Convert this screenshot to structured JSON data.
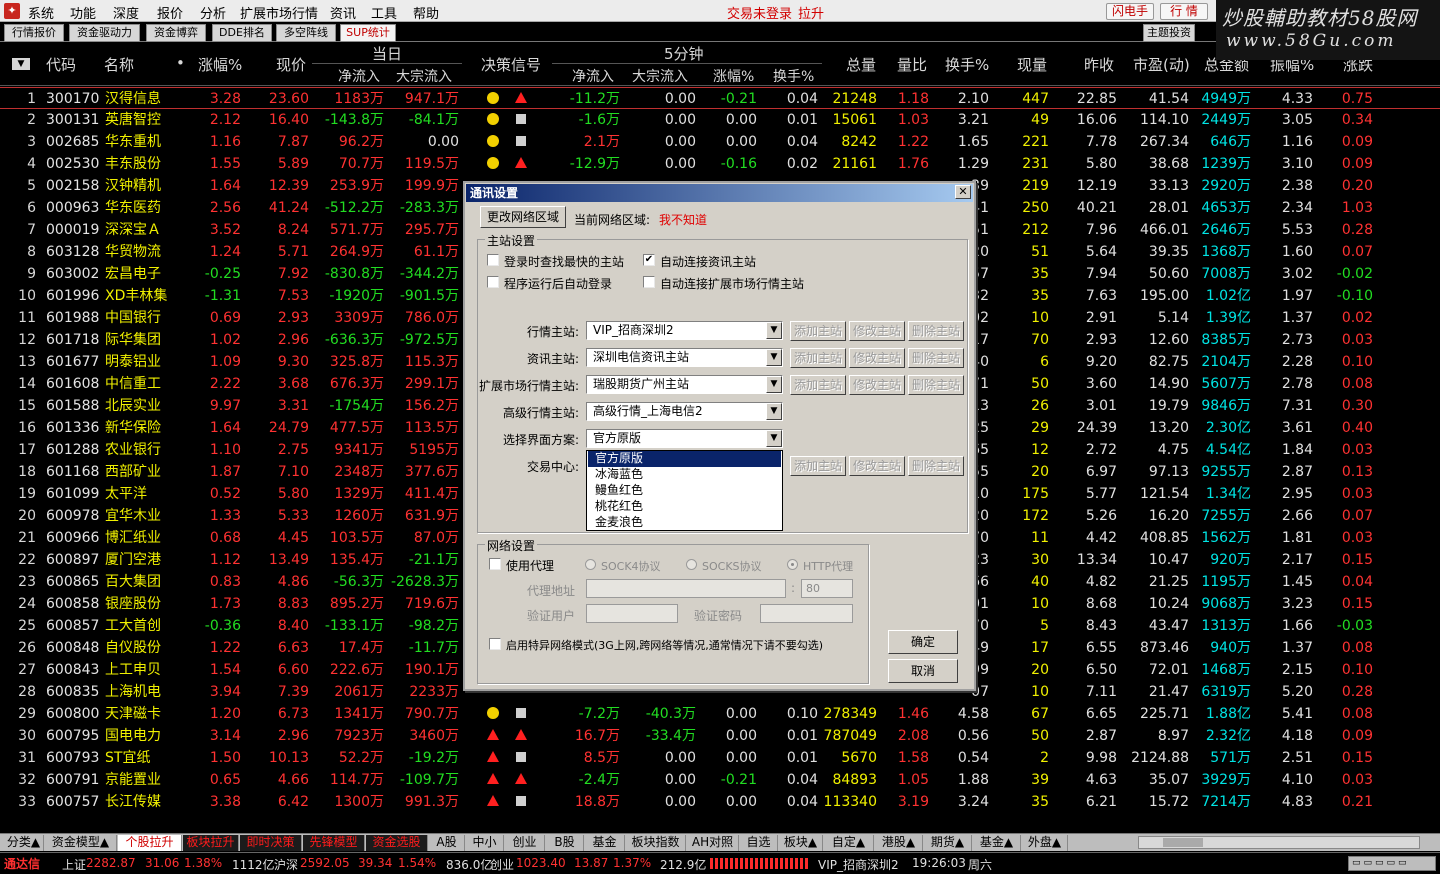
{
  "menubar": {
    "items": [
      "系统",
      "功能",
      "深度",
      "报价",
      "分析",
      "扩展市场行情",
      "资讯",
      "工具",
      "帮助"
    ],
    "trade_status": "交易未登录",
    "pull_up": "拉升",
    "flash_label": "闪电手",
    "quote_label": "行 情"
  },
  "watermark": {
    "line1": "炒股輔助教材58股网",
    "line2": "www.58Gu.com"
  },
  "top_tabs": [
    "行情报价",
    "资金驱动力",
    "资金博弈",
    "DDE排名",
    "多空阵线",
    "SUP统计"
  ],
  "topic_btn": "主题投资",
  "header": {
    "code": "代码",
    "name": "名称",
    "dot": "•",
    "pct": "涨幅%",
    "price": "现价",
    "today": "当日",
    "net_inflow": "净流入",
    "big_net": "大宗流入",
    "decision": "决策信号",
    "five_min": "5分钟",
    "m5_net": "净流入",
    "m5_big": "大宗流入",
    "m5_pct": "涨幅%",
    "m5_turn": "换手%",
    "volume": "总量",
    "vol_ratio": "量比",
    "turnover": "换手%",
    "cur_vol": "现量",
    "prev_close": "昨收",
    "pe": "市盈(动)",
    "amount": "总金额",
    "amplitude": "振幅%",
    "change": "涨跌"
  },
  "rows": [
    {
      "i": "1",
      "code": "300170",
      "name": "汉得信息",
      "pct": "3.28",
      "price": "23.60",
      "net": "1183万",
      "big": "947.1万",
      "s1": "dot",
      "s2": "tri",
      "mnet": "-11.2万",
      "mbig": "0.00",
      "mpct": "-0.21",
      "mturn": "0.04",
      "vol": "21248",
      "vr": "1.18",
      "turn": "2.10",
      "cur": "447",
      "prev": "22.85",
      "pe": "41.54",
      "amt": "4949万",
      "amp": "4.33",
      "chg": "0.75"
    },
    {
      "i": "2",
      "code": "300131",
      "name": "英唐智控",
      "pct": "2.12",
      "price": "16.40",
      "net": "-143.8万",
      "big": "-84.1万",
      "s1": "dot",
      "s2": "sq",
      "mnet": "-1.6万",
      "mbig": "0.00",
      "mpct": "0.00",
      "mturn": "0.01",
      "vol": "15061",
      "vr": "1.03",
      "turn": "3.21",
      "cur": "49",
      "prev": "16.06",
      "pe": "114.10",
      "amt": "2449万",
      "amp": "3.05",
      "chg": "0.34"
    },
    {
      "i": "3",
      "code": "002685",
      "name": "华东重机",
      "pct": "1.16",
      "price": "7.87",
      "net": "96.2万",
      "big": "0.00",
      "s1": "dot",
      "s2": "sq",
      "mnet": "2.1万",
      "mbig": "0.00",
      "mpct": "0.00",
      "mturn": "0.04",
      "vol": "8242",
      "vr": "1.22",
      "turn": "1.65",
      "cur": "221",
      "prev": "7.78",
      "pe": "267.34",
      "amt": "646万",
      "amp": "1.16",
      "chg": "0.09"
    },
    {
      "i": "4",
      "code": "002530",
      "name": "丰东股份",
      "pct": "1.55",
      "price": "5.89",
      "net": "70.7万",
      "big": "119.5万",
      "s1": "dot",
      "s2": "tri",
      "mnet": "-12.9万",
      "mbig": "0.00",
      "mpct": "-0.16",
      "mturn": "0.02",
      "vol": "21161",
      "vr": "1.76",
      "turn": "1.29",
      "cur": "231",
      "prev": "5.80",
      "pe": "38.68",
      "amt": "1239万",
      "amp": "3.10",
      "chg": "0.09"
    },
    {
      "i": "5",
      "code": "002158",
      "name": "汉钟精机",
      "pct": "1.64",
      "price": "12.39",
      "net": "253.9万",
      "big": "199.9万",
      "cur": "219",
      "prev": "12.19",
      "pe": "33.13",
      "amt": "2920万",
      "amp": "2.38",
      "chg": "0.20",
      "hidden": "39"
    },
    {
      "i": "6",
      "code": "000963",
      "name": "华东医药",
      "pct": "2.56",
      "price": "41.24",
      "net": "-512.2万",
      "big": "-283.3万",
      "cur": "250",
      "prev": "40.21",
      "pe": "28.01",
      "amt": "4653万",
      "amp": "2.34",
      "chg": "1.03",
      "hidden": "41"
    },
    {
      "i": "7",
      "code": "000019",
      "name": "深深宝Ａ",
      "pct": "3.52",
      "price": "8.24",
      "net": "571.7万",
      "big": "295.7万",
      "cur": "212",
      "prev": "7.96",
      "pe": "466.01",
      "amt": "2646万",
      "amp": "5.53",
      "chg": "0.28",
      "hidden": "51"
    },
    {
      "i": "8",
      "code": "603128",
      "name": "华贸物流",
      "pct": "1.24",
      "price": "5.71",
      "net": "264.9万",
      "big": "61.1万",
      "cur": "51",
      "prev": "5.64",
      "pe": "39.35",
      "amt": "1368万",
      "amp": "1.60",
      "chg": "0.07",
      "hidden": "20"
    },
    {
      "i": "9",
      "code": "603002",
      "name": "宏昌电子",
      "pct": "-0.25",
      "price": "7.92",
      "net": "-830.8万",
      "big": "-344.2万",
      "cur": "35",
      "prev": "7.94",
      "pe": "50.60",
      "amt": "7008万",
      "amp": "3.02",
      "chg": "-0.02",
      "hidden": "57"
    },
    {
      "i": "10",
      "code": "601996",
      "name": "XD丰林集",
      "pct": "-1.31",
      "price": "7.53",
      "net": "-1920万",
      "big": "-901.5万",
      "cur": "35",
      "prev": "7.63",
      "pe": "195.00",
      "amt": "1.02亿",
      "amp": "1.97",
      "chg": "-0.10",
      "hidden": "32"
    },
    {
      "i": "11",
      "code": "601988",
      "name": "中国银行",
      "pct": "0.69",
      "price": "2.93",
      "net": "3309万",
      "big": "786.0万",
      "cur": "10",
      "prev": "2.91",
      "pe": "5.14",
      "amt": "1.39亿",
      "amp": "1.37",
      "chg": "0.02",
      "hidden": "02"
    },
    {
      "i": "12",
      "code": "601718",
      "name": "际华集团",
      "pct": "1.02",
      "price": "2.96",
      "net": "-636.3万",
      "big": "-972.5万",
      "cur": "70",
      "prev": "2.93",
      "pe": "12.60",
      "amt": "8385万",
      "amp": "2.73",
      "chg": "0.03",
      "hidden": "17"
    },
    {
      "i": "13",
      "code": "601677",
      "name": "明泰铝业",
      "pct": "1.09",
      "price": "9.30",
      "net": "325.8万",
      "big": "115.3万",
      "cur": "6",
      "prev": "9.20",
      "pe": "82.75",
      "amt": "2104万",
      "amp": "2.28",
      "chg": "0.10",
      "hidden": "40"
    },
    {
      "i": "14",
      "code": "601608",
      "name": "中信重工",
      "pct": "2.22",
      "price": "3.68",
      "net": "676.3万",
      "big": "299.1万",
      "cur": "50",
      "prev": "3.60",
      "pe": "14.90",
      "amt": "5607万",
      "amp": "2.78",
      "chg": "0.08",
      "hidden": "71"
    },
    {
      "i": "15",
      "code": "601588",
      "name": "北辰实业",
      "pct": "9.97",
      "price": "3.31",
      "net": "-1754万",
      "big": "156.2万",
      "cur": "26",
      "prev": "3.01",
      "pe": "19.79",
      "amt": "9846万",
      "amp": "7.31",
      "chg": "0.30",
      "hidden": "13"
    },
    {
      "i": "16",
      "code": "601336",
      "name": "新华保险",
      "pct": "1.64",
      "price": "24.79",
      "net": "477.5万",
      "big": "113.5万",
      "cur": "29",
      "prev": "24.39",
      "pe": "13.20",
      "amt": "2.30亿",
      "amp": "3.61",
      "chg": "0.40",
      "hidden": "25"
    },
    {
      "i": "17",
      "code": "601288",
      "name": "农业银行",
      "pct": "1.10",
      "price": "2.75",
      "net": "9341万",
      "big": "5195万",
      "cur": "12",
      "prev": "2.72",
      "pe": "4.75",
      "amt": "4.54亿",
      "amp": "1.84",
      "chg": "0.03",
      "hidden": "65"
    },
    {
      "i": "18",
      "code": "601168",
      "name": "西部矿业",
      "pct": "1.87",
      "price": "7.10",
      "net": "2348万",
      "big": "377.6万",
      "cur": "20",
      "prev": "6.97",
      "pe": "97.13",
      "amt": "9255万",
      "amp": "2.87",
      "chg": "0.13",
      "hidden": "55"
    },
    {
      "i": "19",
      "code": "601099",
      "name": "太平洋",
      "pct": "0.52",
      "price": "5.80",
      "net": "1329万",
      "big": "411.4万",
      "cur": "175",
      "prev": "5.77",
      "pe": "121.54",
      "amt": "1.34亿",
      "amp": "2.95",
      "chg": "0.03",
      "hidden": "10"
    },
    {
      "i": "20",
      "code": "600978",
      "name": "宜华木业",
      "pct": "1.33",
      "price": "5.33",
      "net": "1260万",
      "big": "631.9万",
      "cur": "172",
      "prev": "5.26",
      "pe": "16.20",
      "amt": "7255万",
      "amp": "2.66",
      "chg": "0.07",
      "hidden": "20"
    },
    {
      "i": "21",
      "code": "600966",
      "name": "博汇纸业",
      "pct": "0.68",
      "price": "4.45",
      "net": "103.5万",
      "big": "87.0万",
      "cur": "11",
      "prev": "4.42",
      "pe": "408.85",
      "amt": "1562万",
      "amp": "1.81",
      "chg": "0.03",
      "hidden": "70"
    },
    {
      "i": "22",
      "code": "600897",
      "name": "厦门空港",
      "pct": "1.12",
      "price": "13.49",
      "net": "135.4万",
      "big": "-21.1万",
      "cur": "30",
      "prev": "13.34",
      "pe": "10.47",
      "amt": "920万",
      "amp": "2.17",
      "chg": "0.15",
      "hidden": "23"
    },
    {
      "i": "23",
      "code": "600865",
      "name": "百大集团",
      "pct": "0.83",
      "price": "4.86",
      "net": "-56.3万",
      "big": "-2628.3万",
      "cur": "40",
      "prev": "4.82",
      "pe": "21.25",
      "amt": "1195万",
      "amp": "1.45",
      "chg": "0.04",
      "hidden": "66"
    },
    {
      "i": "24",
      "code": "600858",
      "name": "银座股份",
      "pct": "1.73",
      "price": "8.83",
      "net": "895.2万",
      "big": "719.6万",
      "cur": "10",
      "prev": "8.68",
      "pe": "10.24",
      "amt": "9068万",
      "amp": "3.23",
      "chg": "0.15",
      "hidden": "01"
    },
    {
      "i": "25",
      "code": "600857",
      "name": "工大首创",
      "pct": "-0.36",
      "price": "8.40",
      "net": "-133.1万",
      "big": "-98.2万",
      "cur": "5",
      "prev": "8.43",
      "pe": "43.47",
      "amt": "1313万",
      "amp": "1.66",
      "chg": "-0.03",
      "hidden": "70"
    },
    {
      "i": "26",
      "code": "600848",
      "name": "自仪股份",
      "pct": "1.22",
      "price": "6.63",
      "net": "17.4万",
      "big": "-11.7万",
      "cur": "17",
      "prev": "6.55",
      "pe": "873.46",
      "amt": "940万",
      "amp": "1.37",
      "chg": "0.08",
      "hidden": "49"
    },
    {
      "i": "27",
      "code": "600843",
      "name": "上工申贝",
      "pct": "1.54",
      "price": "6.60",
      "net": "222.6万",
      "big": "190.1万",
      "cur": "20",
      "prev": "6.50",
      "pe": "72.01",
      "amt": "1468万",
      "amp": "2.15",
      "chg": "0.10",
      "hidden": "99"
    },
    {
      "i": "28",
      "code": "600835",
      "name": "上海机电",
      "pct": "3.94",
      "price": "7.39",
      "net": "2061万",
      "big": "2233万",
      "cur": "10",
      "prev": "7.11",
      "pe": "21.47",
      "amt": "6319万",
      "amp": "5.20",
      "chg": "0.28",
      "hidden": "07"
    },
    {
      "i": "29",
      "code": "600800",
      "name": "天津磁卡",
      "pct": "1.20",
      "price": "6.73",
      "net": "1341万",
      "big": "790.7万",
      "s1": "dot",
      "s2": "sq",
      "mnet": "-7.2万",
      "mbig": "-40.3万",
      "mpct": "0.00",
      "mturn": "0.10",
      "vol": "278349",
      "vr": "1.46",
      "turn": "4.58",
      "cur": "67",
      "prev": "6.65",
      "pe": "225.71",
      "amt": "1.88亿",
      "amp": "5.41",
      "chg": "0.08"
    },
    {
      "i": "30",
      "code": "600795",
      "name": "国电电力",
      "pct": "3.14",
      "price": "2.96",
      "net": "7923万",
      "big": "3460万",
      "s1": "tri",
      "s2": "tri",
      "mnet": "16.7万",
      "mbig": "-33.4万",
      "mpct": "0.00",
      "mturn": "0.01",
      "vol": "787049",
      "vr": "2.08",
      "turn": "0.56",
      "cur": "50",
      "prev": "2.87",
      "pe": "8.97",
      "amt": "2.32亿",
      "amp": "4.18",
      "chg": "0.09"
    },
    {
      "i": "31",
      "code": "600793",
      "name": "ST宜纸",
      "pct": "1.50",
      "price": "10.13",
      "net": "52.2万",
      "big": "-19.2万",
      "s1": "tri",
      "s2": "sq",
      "mnet": "8.5万",
      "mbig": "0.00",
      "mpct": "0.00",
      "mturn": "0.01",
      "vol": "5670",
      "vr": "1.58",
      "turn": "0.54",
      "cur": "2",
      "prev": "9.98",
      "pe": "2124.88",
      "amt": "571万",
      "amp": "2.51",
      "chg": "0.15"
    },
    {
      "i": "32",
      "code": "600791",
      "name": "京能置业",
      "pct": "0.65",
      "price": "4.66",
      "net": "114.7万",
      "big": "-109.7万",
      "s1": "tri",
      "s2": "tri",
      "mnet": "-2.4万",
      "mbig": "0.00",
      "mpct": "-0.21",
      "mturn": "0.04",
      "vol": "84893",
      "vr": "1.05",
      "turn": "1.88",
      "cur": "39",
      "prev": "4.63",
      "pe": "35.07",
      "amt": "3929万",
      "amp": "4.10",
      "chg": "0.03"
    },
    {
      "i": "33",
      "code": "600757",
      "name": "长江传媒",
      "pct": "3.38",
      "price": "6.42",
      "net": "1300万",
      "big": "991.3万",
      "s1": "tri",
      "s2": "sq",
      "mnet": "18.8万",
      "mbig": "0.00",
      "mpct": "0.00",
      "mturn": "0.04",
      "vol": "113340",
      "vr": "3.19",
      "turn": "3.24",
      "cur": "35",
      "prev": "6.21",
      "pe": "15.72",
      "amt": "7214万",
      "amp": "4.83",
      "chg": "0.21"
    }
  ],
  "row28_partial": {
    "mnet": "256.4万",
    "mbig": "221.8万",
    "mpct": "0.13",
    "mturn": "0.05",
    "vol": "66321",
    "vr": "2.12",
    "turn": "1.07"
  },
  "bottom_tabs": [
    "分类▲",
    "资金模型▲",
    "个股拉升",
    "板块拉升",
    "即时决策",
    "先锋模型",
    "资金选股",
    "A股",
    "中小",
    "创业",
    "B股",
    "基金",
    "板块指数",
    "AH对照",
    "自选",
    "板块▲",
    "自定▲",
    "港股▲",
    "期货▲",
    "基金▲",
    "外盘▲"
  ],
  "status": {
    "brand": "通达信",
    "sh_label": "上证",
    "sh_val": "2282.87",
    "sh_chg": "31.06",
    "sh_pct": "1.38%",
    "sh_amt": "1112亿",
    "hs_label": "沪深",
    "hs_val": "2592.05",
    "hs_chg": "39.34",
    "hs_pct": "1.54%",
    "hs_amt": "836.0亿",
    "cy_label": "创业",
    "cy_val": "1023.40",
    "cy_chg": "13.87",
    "cy_pct": "1.37%",
    "cy_amt": "212.9亿",
    "server": "VIP_招商深圳2",
    "time": "19:26:03",
    "weekday": "周六"
  },
  "dialog": {
    "title": "通讯设置",
    "change_region": "更改网络区域",
    "current_region_label": "当前网络区域:",
    "current_region_value": "我不知道",
    "main_group": "主站设置",
    "chk_fastest": "登录时查找最快的主站",
    "chk_auto_news": "自动连接资讯主站",
    "chk_auto_login": "程序运行后自动登录",
    "chk_auto_ext": "自动连接扩展市场行情主站",
    "quote_label": "行情主站:",
    "quote_value": "VIP_招商深圳2",
    "news_label": "资讯主站:",
    "news_value": "深圳电信资讯主站",
    "ext_label": "扩展市场行情主站:",
    "ext_value": "瑞股期货广州主站",
    "adv_label": "高级行情主站:",
    "adv_value": "高级行情_上海电信2",
    "scheme_label": "选择界面方案:",
    "scheme_value": "官方原版",
    "trade_label": "交易中心:",
    "add_btn": "添加主站",
    "edit_btn": "修改主站",
    "del_btn": "删除主站",
    "scheme_options": [
      "官方原版",
      "冰海蓝色",
      "鳗鱼红色",
      "桃花红色",
      "金麦浪色"
    ],
    "net_group": "网络设置",
    "chk_proxy": "使用代理",
    "socks4": "SOCK4协议",
    "socks5": "SOCKS协议",
    "http": "HTTP代理",
    "proxy_addr_label": "代理地址",
    "port_sep": ":",
    "port_value": "80",
    "user_label": "验证用户",
    "pwd_label": "验证密码",
    "chk_special": "启用特异网络模式(3G上网,跨网络等情况,通常情况下请不要勾选)",
    "ok": "确定",
    "cancel": "取消"
  },
  "colors": {
    "up": "#ff3232",
    "down": "#22dd22",
    "yellow": "#f0f000",
    "header": "#d8d8d8"
  }
}
